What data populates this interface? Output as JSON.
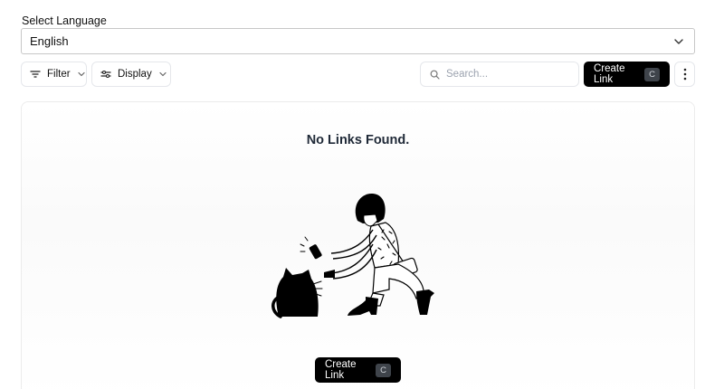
{
  "language": {
    "label": "Select Language",
    "selected": "English"
  },
  "toolbar": {
    "filter_label": "Filter",
    "display_label": "Display",
    "search_placeholder": "Search...",
    "create_label": "Create Link",
    "create_shortcut": "C"
  },
  "empty_state": {
    "title": "No Links Found.",
    "create_label": "Create Link",
    "create_shortcut": "C"
  },
  "icons": {
    "language_chevron": "chevron-down-icon",
    "filter": "filter-icon",
    "display": "sliders-icon",
    "search": "search-icon",
    "more": "more-vertical-icon"
  },
  "colors": {
    "primary": "#000000",
    "border": "#e5e7eb",
    "placeholder": "#9ca3af"
  }
}
